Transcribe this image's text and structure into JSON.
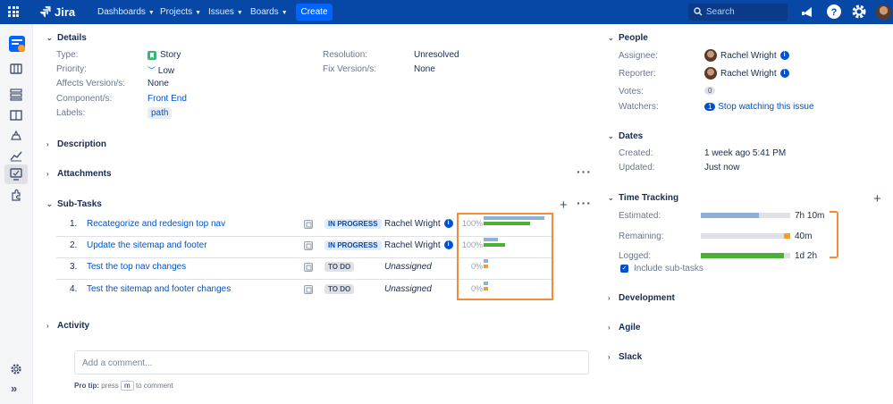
{
  "topnav": {
    "logo_text": "Jira",
    "items": [
      "Dashboards",
      "Projects",
      "Issues",
      "Boards"
    ],
    "create_label": "Create",
    "search_placeholder": "Search"
  },
  "details": {
    "heading": "Details",
    "left": [
      {
        "label": "Type:",
        "value": "Story"
      },
      {
        "label": "Priority:",
        "value": "Low"
      },
      {
        "label": "Affects Version/s:",
        "value": "None"
      },
      {
        "label": "Component/s:",
        "value": "Front End"
      },
      {
        "label": "Labels:",
        "value": "path"
      }
    ],
    "right": [
      {
        "label": "Resolution:",
        "value": "Unresolved"
      },
      {
        "label": "Fix Version/s:",
        "value": "None"
      }
    ]
  },
  "sections": {
    "description": "Description",
    "attachments": "Attachments",
    "subtasks": "Sub-Tasks",
    "activity": "Activity"
  },
  "subtasks": [
    {
      "num": "1.",
      "title": "Recategorize and redesign top nav",
      "status": "IN PROGRESS",
      "assignee": "Rachel Wright",
      "pct": "100%",
      "est": 0.85,
      "logged": 0.65,
      "remaining": 0
    },
    {
      "num": "2.",
      "title": "Update the sitemap and footer",
      "status": "IN PROGRESS",
      "assignee": "Rachel Wright",
      "pct": "100%",
      "est": 0.2,
      "logged": 0.3,
      "remaining": 0
    },
    {
      "num": "3.",
      "title": "Test the top nav changes",
      "status": "TO DO",
      "assignee": "Unassigned",
      "pct": "0%",
      "est": 0.06,
      "logged": 0,
      "remaining": 0.06
    },
    {
      "num": "4.",
      "title": "Test the sitemap and footer changes",
      "status": "TO DO",
      "assignee": "Unassigned",
      "pct": "0%",
      "est": 0.06,
      "logged": 0,
      "remaining": 0.06
    }
  ],
  "comment": {
    "placeholder": "Add a comment...",
    "tip_prefix": "Pro tip:",
    "tip_press": "press",
    "tip_key": "m",
    "tip_suffix": "to comment"
  },
  "people": {
    "heading": "People",
    "assignee_label": "Assignee:",
    "assignee": "Rachel Wright",
    "reporter_label": "Reporter:",
    "reporter": "Rachel Wright",
    "votes_label": "Votes:",
    "votes": "0",
    "watchers_label": "Watchers:",
    "watchers_count": "1",
    "watchers_link": "Stop watching this issue"
  },
  "dates": {
    "heading": "Dates",
    "created_label": "Created:",
    "created": "1 week ago 5:41 PM",
    "updated_label": "Updated:",
    "updated": "Just now"
  },
  "time_tracking": {
    "heading": "Time Tracking",
    "rows": [
      {
        "label": "Estimated:",
        "value": "7h 10m",
        "fill": 0.65,
        "color": "#8eb0d9"
      },
      {
        "label": "Remaining:",
        "value": "40m",
        "fill": 0.93,
        "color": "#ff991f"
      },
      {
        "label": "Logged:",
        "value": "1d 2h",
        "fill": 0.93,
        "color": "#4caf37"
      }
    ],
    "include_subtasks": "Include sub-tasks"
  },
  "collapsed": [
    "Development",
    "Agile",
    "Slack"
  ]
}
